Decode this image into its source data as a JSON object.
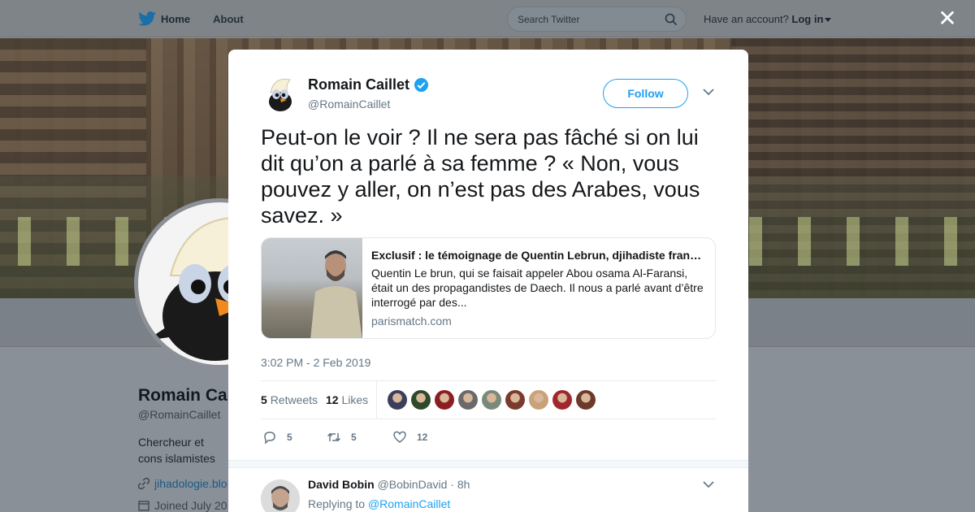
{
  "nav": {
    "home": "Home",
    "about": "About",
    "search_placeholder": "Search Twitter",
    "have_account": "Have an account?",
    "login": "Log in"
  },
  "profile": {
    "name": "Romain Ca",
    "handle": "@RomainCaillet",
    "bio": "Chercheur et cons islamistes",
    "link": "jihadologie.blo",
    "joined": "Joined July 20"
  },
  "tweet": {
    "author_name": "Romain Caillet",
    "author_handle": "@RomainCaillet",
    "follow_label": "Follow",
    "text": "Peut-on le voir ? Il ne sera pas fâché si on lui dit qu’on a parlé à sa femme ? « Non, vous pouvez y aller, on n’est pas des Arabes, vous savez. »",
    "card": {
      "title": "Exclusif : le témoignage de Quentin Lebrun, djihadiste français",
      "description": "Quentin Le brun, qui se faisait appeler Abou osama Al-Faransi, était un des propagandistes de Daech. Il nous a parlé avant d’être interrogé par des...",
      "domain": "parismatch.com"
    },
    "timestamp": "3:02 PM - 2 Feb 2019",
    "retweets_count": "5",
    "retweets_label": "Retweets",
    "likes_count": "12",
    "likes_label": "Likes",
    "liker_colors": [
      "#3a3f5c",
      "#2d4a2a",
      "#8b1e22",
      "#6a6a6a",
      "#7a8a7a",
      "#7a3b2e",
      "#c9a27a",
      "#a0282c",
      "#6b3a2a"
    ],
    "actions": {
      "replies": "5",
      "retweets": "5",
      "likes": "12"
    }
  },
  "reply": {
    "name": "David Bobin",
    "handle": "@BobinDavid",
    "time": "· 8h",
    "replying_to_label": "Replying to",
    "replying_to_handle": "@RomainCaillet"
  }
}
